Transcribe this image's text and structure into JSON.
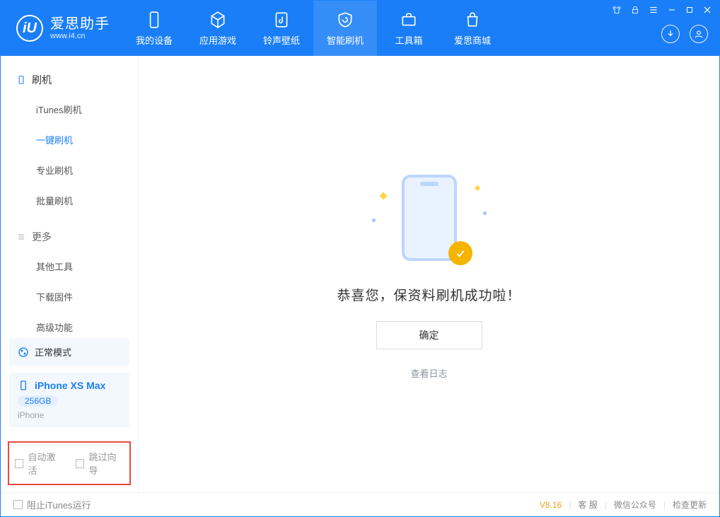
{
  "app": {
    "name_cn": "爱思助手",
    "name_en": "www.i4.cn",
    "logo_letter": "iU"
  },
  "nav": {
    "tabs": [
      {
        "label": "我的设备"
      },
      {
        "label": "应用游戏"
      },
      {
        "label": "铃声壁纸"
      },
      {
        "label": "智能刷机"
      },
      {
        "label": "工具箱"
      },
      {
        "label": "爱思商城"
      }
    ],
    "active_index": 3
  },
  "sidebar": {
    "groups": [
      {
        "title": "刷机",
        "items": [
          {
            "label": "iTunes刷机"
          },
          {
            "label": "一键刷机"
          },
          {
            "label": "专业刷机"
          },
          {
            "label": "批量刷机"
          }
        ],
        "active_index": 1
      },
      {
        "title": "更多",
        "items": [
          {
            "label": "其他工具"
          },
          {
            "label": "下载固件"
          },
          {
            "label": "高级功能"
          }
        ]
      }
    ]
  },
  "mode_card": {
    "label": "正常模式"
  },
  "device_card": {
    "name": "iPhone XS Max",
    "storage": "256GB",
    "type": "iPhone"
  },
  "options": {
    "auto_activate": "自动激活",
    "skip_guide": "跳过向导"
  },
  "main": {
    "success_text": "恭喜您，保资料刷机成功啦！",
    "ok_label": "确定",
    "log_link": "查看日志"
  },
  "status": {
    "block_itunes": "阻止iTunes运行",
    "version": "V8.16",
    "links": {
      "service": "客 服",
      "wechat": "微信公众号",
      "update": "检查更新"
    }
  }
}
